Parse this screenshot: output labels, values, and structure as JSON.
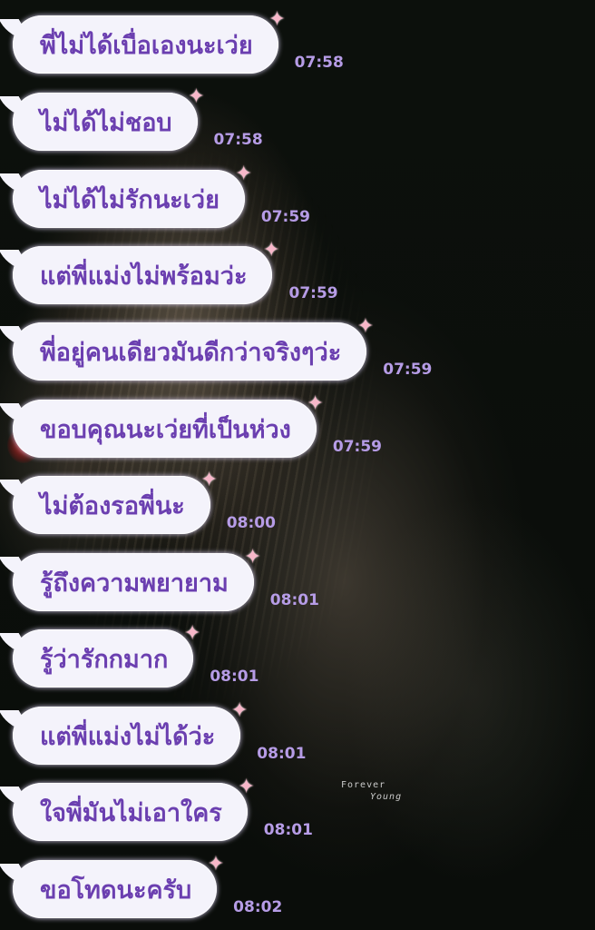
{
  "messages": [
    {
      "text": "พี่ไม่ได้เบื่อเองนะเว่ย",
      "time": "07:58"
    },
    {
      "text": "ไม่ได้ไม่ชอบ",
      "time": "07:58"
    },
    {
      "text": "ไม่ได้ไม่รักนะเว่ย",
      "time": "07:59"
    },
    {
      "text": "แต่พี่แม่งไม่พร้อมว่ะ",
      "time": "07:59"
    },
    {
      "text": "พี่อยู่คนเดียวมันดีกว่าจริงๆว่ะ",
      "time": "07:59"
    },
    {
      "text": "ขอบคุณนะเว่ยที่เป็นห่วง",
      "time": "07:59"
    },
    {
      "text": "ไม่ต้องรอพี่นะ",
      "time": "08:00"
    },
    {
      "text": "รู้ถึงความพยายาม",
      "time": "08:01"
    },
    {
      "text": "รู้ว่ารักกมาก",
      "time": "08:01"
    },
    {
      "text": "แต่พี่แม่งไม่ได้ว่ะ",
      "time": "08:01"
    },
    {
      "text": "ใจพี่มันไม่เอาใคร",
      "time": "08:01"
    },
    {
      "text": "ขอโทดนะครับ",
      "time": "08:02"
    }
  ],
  "decor": {
    "star_icon": "pink-star-icon",
    "watermark_line1": "Forever",
    "watermark_line2": "Young"
  },
  "colors": {
    "bubble_bg": "#f4f3fb",
    "message_text": "#6b3fb0",
    "time_text": "#b69ce6",
    "star": "#f7b7c9"
  }
}
